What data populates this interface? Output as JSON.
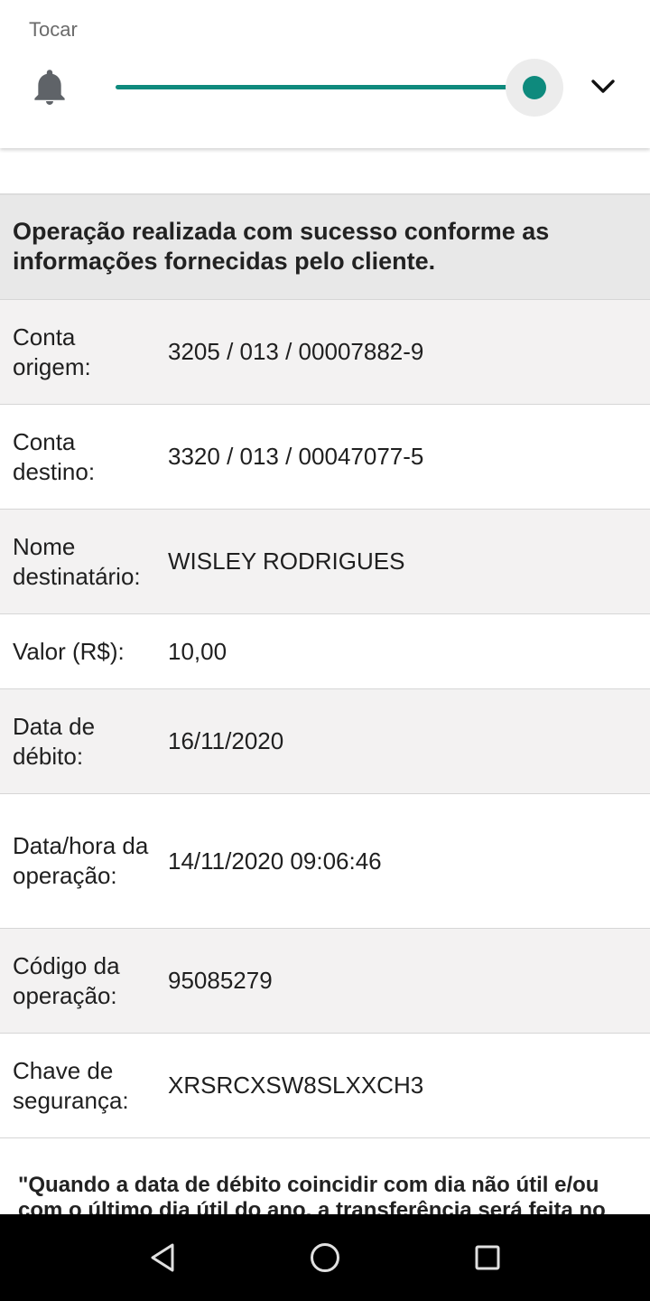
{
  "volume_panel": {
    "label": "Tocar",
    "level": 1.0,
    "icon": "bell-icon",
    "expand_icon": "chevron-down-icon",
    "accent_color": "#0e8a7d"
  },
  "receipt": {
    "success_message": "Operação realizada com sucesso conforme as informações fornecidas pelo cliente.",
    "rows": [
      {
        "label": "Conta origem:",
        "value": "3205 / 013 / 00007882-9"
      },
      {
        "label": "Conta destino:",
        "value": "3320 / 013 / 00047077-5"
      },
      {
        "label": "Nome destinatário:",
        "value": "WISLEY RODRIGUES"
      },
      {
        "label": "Valor (R$):",
        "value": "10,00"
      },
      {
        "label": "Data de débito:",
        "value": "16/11/2020"
      },
      {
        "label": "Data/hora da operação:",
        "value": "14/11/2020 09:06:46"
      },
      {
        "label": "Código da operação:",
        "value": "95085279"
      },
      {
        "label": "Chave de segurança:",
        "value": "XRSRCXSW8SLXXCH3"
      }
    ],
    "disclaimer": "\"Quando a data de débito coincidir com dia não útil e/ou com o último dia útil do ano, a transferência será feita no"
  },
  "nav_bar": {
    "back": "back-icon",
    "home": "home-icon",
    "recents": "recents-icon"
  }
}
